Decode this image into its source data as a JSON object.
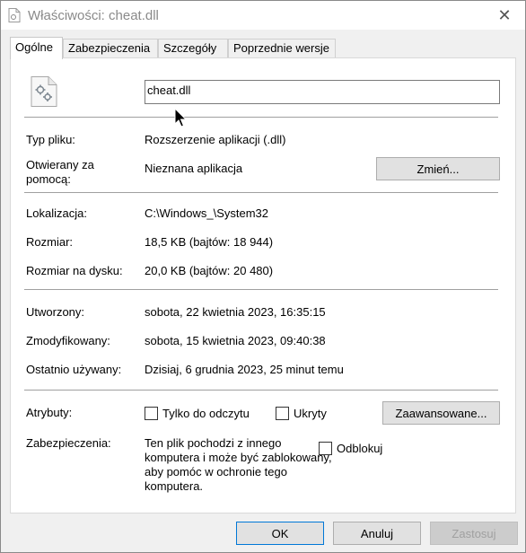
{
  "window": {
    "title": "Właściwości: cheat.dll"
  },
  "tabs": [
    {
      "label": "Ogólne"
    },
    {
      "label": "Zabezpieczenia"
    },
    {
      "label": "Szczegóły"
    },
    {
      "label": "Poprzednie wersje"
    }
  ],
  "file": {
    "name": "cheat.dll"
  },
  "details": {
    "type_label": "Typ pliku:",
    "type_value": "Rozszerzenie aplikacji (.dll)",
    "opens_label_1": "Otwierany za",
    "opens_label_2": "pomocą:",
    "opens_value": "Nieznana aplikacja",
    "change_button": "Zmień...",
    "location_label": "Lokalizacja:",
    "location_value": "C:\\Windows_\\System32",
    "size_label": "Rozmiar:",
    "size_value": "18,5 KB (bajtów: 18 944)",
    "disk_label": "Rozmiar na dysku:",
    "disk_value": "20,0 KB (bajtów: 20 480)",
    "created_label": "Utworzony:",
    "created_value": "sobota, 22 kwietnia 2023, 16:35:15",
    "modified_label": "Zmodyfikowany:",
    "modified_value": "sobota, 15 kwietnia 2023, 09:40:38",
    "accessed_label": "Ostatnio używany:",
    "accessed_value": "Dzisiaj, 6 grudnia 2023, 25 minut temu",
    "attributes_label": "Atrybuty:",
    "readonly_label": "Tylko do odczytu",
    "hidden_label": "Ukryty",
    "advanced_button": "Zaawansowane...",
    "security_label": "Zabezpieczenia:",
    "security_text": "Ten plik pochodzi z innego komputera i może być zablokowany, aby pomóc w ochronie tego komputera.",
    "unblock_label": "Odblokuj"
  },
  "footer": {
    "ok": "OK",
    "cancel": "Anuluj",
    "apply": "Zastosuj"
  }
}
